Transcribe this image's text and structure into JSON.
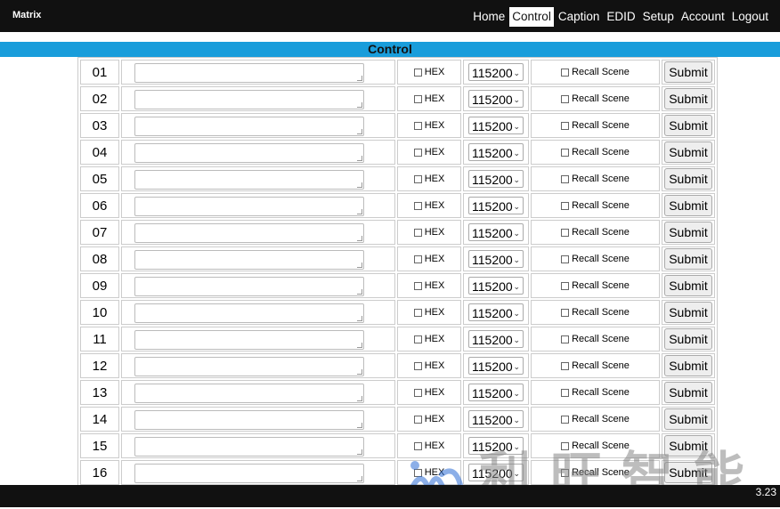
{
  "brand": "Matrix",
  "nav": [
    "Home",
    "Control",
    "Caption",
    "EDID",
    "Setup",
    "Account",
    "Logout"
  ],
  "nav_active": "Control",
  "section_title": "Control",
  "rows": [
    {
      "num": "01",
      "hex_label": "HEX",
      "baud": "115200",
      "recall_label": "Recall Scene",
      "submit_label": "Submit"
    },
    {
      "num": "02",
      "hex_label": "HEX",
      "baud": "115200",
      "recall_label": "Recall Scene",
      "submit_label": "Submit"
    },
    {
      "num": "03",
      "hex_label": "HEX",
      "baud": "115200",
      "recall_label": "Recall Scene",
      "submit_label": "Submit"
    },
    {
      "num": "04",
      "hex_label": "HEX",
      "baud": "115200",
      "recall_label": "Recall Scene",
      "submit_label": "Submit"
    },
    {
      "num": "05",
      "hex_label": "HEX",
      "baud": "115200",
      "recall_label": "Recall Scene",
      "submit_label": "Submit"
    },
    {
      "num": "06",
      "hex_label": "HEX",
      "baud": "115200",
      "recall_label": "Recall Scene",
      "submit_label": "Submit"
    },
    {
      "num": "07",
      "hex_label": "HEX",
      "baud": "115200",
      "recall_label": "Recall Scene",
      "submit_label": "Submit"
    },
    {
      "num": "08",
      "hex_label": "HEX",
      "baud": "115200",
      "recall_label": "Recall Scene",
      "submit_label": "Submit"
    },
    {
      "num": "09",
      "hex_label": "HEX",
      "baud": "115200",
      "recall_label": "Recall Scene",
      "submit_label": "Submit"
    },
    {
      "num": "10",
      "hex_label": "HEX",
      "baud": "115200",
      "recall_label": "Recall Scene",
      "submit_label": "Submit"
    },
    {
      "num": "11",
      "hex_label": "HEX",
      "baud": "115200",
      "recall_label": "Recall Scene",
      "submit_label": "Submit"
    },
    {
      "num": "12",
      "hex_label": "HEX",
      "baud": "115200",
      "recall_label": "Recall Scene",
      "submit_label": "Submit"
    },
    {
      "num": "13",
      "hex_label": "HEX",
      "baud": "115200",
      "recall_label": "Recall Scene",
      "submit_label": "Submit"
    },
    {
      "num": "14",
      "hex_label": "HEX",
      "baud": "115200",
      "recall_label": "Recall Scene",
      "submit_label": "Submit"
    },
    {
      "num": "15",
      "hex_label": "HEX",
      "baud": "115200",
      "recall_label": "Recall Scene",
      "submit_label": "Submit"
    },
    {
      "num": "16",
      "hex_label": "HEX",
      "baud": "115200",
      "recall_label": "Recall Scene",
      "submit_label": "Submit"
    }
  ],
  "version": "3.23",
  "watermark_text": "利旺智能",
  "colors": {
    "title_bar": "#199ddb",
    "topbar": "#111111"
  }
}
